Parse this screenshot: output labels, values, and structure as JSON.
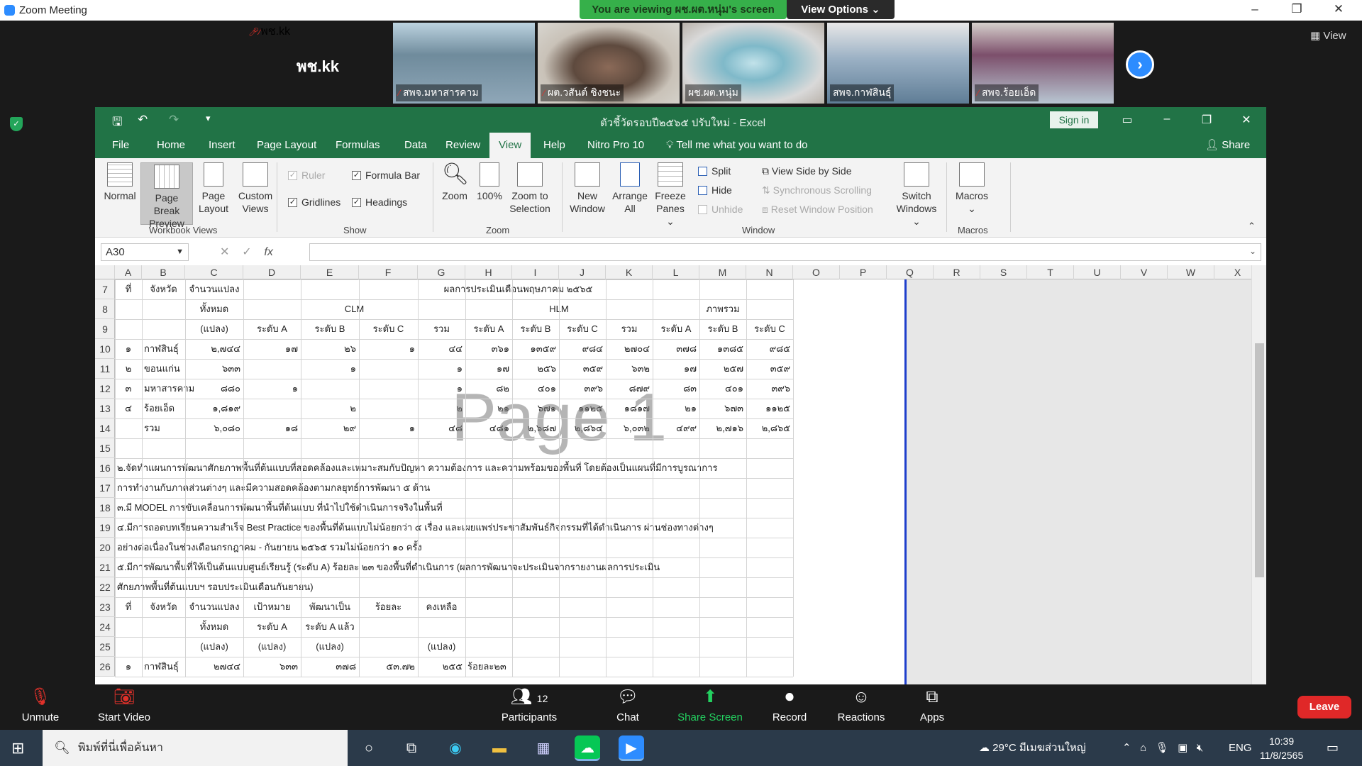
{
  "zoom": {
    "window_title": "Zoom Meeting",
    "viewing_banner": "You are viewing ผช.ผต.หนุ่ม's screen",
    "view_options": "View Options ⌄",
    "view_button": "View",
    "speaker_name_big": "พช.kk",
    "participants": [
      {
        "name": "พช.kk",
        "muted": true
      },
      {
        "name": "สพจ.มหาสารคาม",
        "muted": true
      },
      {
        "name": "ผต.วสันต์ ชิงชนะ",
        "muted": true
      },
      {
        "name": "ผช.ผต.หนุ่ม",
        "muted": false
      },
      {
        "name": "สพจ.กาฬสินธุ์",
        "muted": false
      },
      {
        "name": "สพจ.ร้อยเอ็ด",
        "muted": true
      }
    ],
    "toolbar": {
      "unmute": "Unmute",
      "start_video": "Start Video",
      "participants": "Participants",
      "participants_count": "12",
      "chat": "Chat",
      "share_screen": "Share Screen",
      "record": "Record",
      "reactions": "Reactions",
      "apps": "Apps",
      "leave": "Leave"
    }
  },
  "excel": {
    "title": "ตัวชี้วัดรอบปี๒๕๖๕ ปรับใหม่  -  Excel",
    "sign_in": "Sign in",
    "tabs": [
      "File",
      "Home",
      "Insert",
      "Page Layout",
      "Formulas",
      "Data",
      "Review",
      "View",
      "Help",
      "Nitro Pro 10"
    ],
    "active_tab": "View",
    "tell_me": "Tell me what you want to do",
    "share": "Share",
    "ribbon": {
      "normal": "Normal",
      "page_break_1": "Page Break",
      "page_break_2": "Preview",
      "page_layout_1": "Page",
      "page_layout_2": "Layout",
      "custom_views_1": "Custom",
      "custom_views_2": "Views",
      "group_workbook_views": "Workbook Views",
      "ruler": "Ruler",
      "formula_bar": "Formula Bar",
      "gridlines": "Gridlines",
      "headings": "Headings",
      "group_show": "Show",
      "zoom": "Zoom",
      "zoom100": "100%",
      "zoom_sel_1": "Zoom to",
      "zoom_sel_2": "Selection",
      "group_zoom": "Zoom",
      "new_window_1": "New",
      "new_window_2": "Window",
      "arrange_1": "Arrange",
      "arrange_2": "All",
      "freeze_1": "Freeze",
      "freeze_2": "Panes ⌄",
      "split": "Split",
      "hide": "Hide",
      "unhide": "Unhide",
      "view_side": "View Side by Side",
      "sync_scroll": "Synchronous Scrolling",
      "reset_pos": "Reset Window Position",
      "switch_1": "Switch",
      "switch_2": "Windows ⌄",
      "group_window": "Window",
      "macros": "Macros",
      "group_macros": "Macros"
    },
    "name_box": "A30",
    "fx": "fx",
    "columns": [
      "A",
      "B",
      "C",
      "D",
      "E",
      "F",
      "G",
      "H",
      "I",
      "J",
      "K",
      "L",
      "M",
      "N",
      "O",
      "P",
      "Q",
      "R",
      "S",
      "T",
      "U",
      "V",
      "W",
      "X"
    ],
    "rows": [
      "7",
      "8",
      "9",
      "10",
      "11",
      "12",
      "13",
      "14",
      "15",
      "16",
      "17",
      "18",
      "19",
      "20",
      "21",
      "22",
      "23",
      "24",
      "25",
      "26"
    ],
    "watermark": "Page 1",
    "sheet": {
      "r7": {
        "a": "ที่",
        "b": "จังหวัด",
        "c": "จำนวนแปลง",
        "merged": "ผลการประเมินเดือนพฤษภาคม ๒๕๖๕"
      },
      "r8": {
        "c": "ทั้งหมด",
        "clm": "CLM",
        "hlm": "HLM",
        "total": "ภาพรวม"
      },
      "r9": {
        "c": "(แปลง)",
        "d": "ระดับ A",
        "e": "ระดับ B",
        "f": "ระดับ C",
        "g": "รวม",
        "h": "ระดับ A",
        "i": "ระดับ B",
        "j": "ระดับ C",
        "k": "รวม",
        "l": "ระดับ A",
        "m": "ระดับ B",
        "n": "ระดับ C"
      },
      "data": [
        [
          "๑",
          "กาฬสินธุ์",
          "๒,๗๔๔",
          "๑๗",
          "๒๖",
          "๑",
          "๔๔",
          "๓๖๑",
          "๑๓๕๙",
          "๙๘๔",
          "๒๗๐๔",
          "๓๗๘",
          "๑๓๘๕",
          "๙๘๕"
        ],
        [
          "๒",
          "ขอนแก่น",
          "๖๓๓",
          "",
          "๑",
          "",
          "๑",
          "๑๗",
          "๒๕๖",
          "๓๕๙",
          "๖๓๒",
          "๑๗",
          "๒๕๗",
          "๓๕๙"
        ],
        [
          "๓",
          "มหาสารคาม",
          "๘๘๐",
          "๑",
          "",
          "",
          "๑",
          "๘๒",
          "๔๐๑",
          "๓๙๖",
          "๘๗๙",
          "๘๓",
          "๔๐๑",
          "๓๙๖"
        ],
        [
          "๔",
          "ร้อยเอ็ด",
          "๑,๘๑๙",
          "",
          "๒",
          "",
          "๒",
          "๒๑",
          "๖๗๑",
          "๑๑๒๕",
          "๑๘๑๗",
          "๒๑",
          "๖๗๓",
          "๑๑๒๕"
        ],
        [
          "",
          "รวม",
          "๖,๐๘๐",
          "๑๘",
          "๒๙",
          "๑",
          "๔๘",
          "๔๘๑",
          "๒,๖๘๗",
          "๒,๘๖๔",
          "๖,๐๓๒",
          "๔๙๙",
          "๒,๗๑๖",
          "๒,๘๖๕"
        ]
      ],
      "notes": [
        "๒.จัดทำแผนการพัฒนาศักยภาพพื้นที่ต้นแบบที่สอดคล้องและเหมาะสมกับปัญหา ความต้องการ และความพร้อมของพื้นที่ โดยต้องเป็นแผนที่มีการบูรณาการ",
        "การทำงานกับภาคส่วนต่างๆ และมีความสอดคล้องตามกลยุทธ์การพัฒนา ๕ ด้าน",
        "๓.มี MODEL การขับเคลื่อนการพัฒนาพื้นที่ต้นแบบ ที่นำไปใช้ดำเนินการจริงในพื้นที่",
        "๔.มีการถอดบทเรียนความสำเร็จ Best Practice ของพื้นที่ต้นแบบไม่น้อยกว่า ๕ เรื่อง และเผยแพร่ประชาสัมพันธ์กิจกรรมที่ได้ดำเนินการ ผ่านช่องทางต่างๆ",
        "อย่างต่อเนื่องในช่วงเดือนกรกฎาคม - กันยายน ๒๕๖๕ รวมไม่น้อยกว่า ๑๐ ครั้ง",
        "๕.มีการพัฒนาพื้นที่ให้เป็นต้นแบบศูนย์เรียนรู้ (ระดับ A) ร้อยละ ๒๓ ของพื้นที่ดำเนินการ (ผลการพัฒนาจะประเมินจากรายงานผลการประเมิน",
        "ศักยภาพพื้นที่ต้นแบบฯ รอบประเมินเดือนกันยายน)"
      ],
      "r23": {
        "a": "ที่",
        "b": "จังหวัด",
        "c": "จำนวนแปลง",
        "d": "เป้าหมาย",
        "e": "พัฒนาเป็น",
        "f": "ร้อยละ",
        "g": "คงเหลือ"
      },
      "r24": {
        "c": "ทั้งหมด",
        "d": "ระดับ A",
        "e": "ระดับ A แล้ว"
      },
      "r25": {
        "c": "(แปลง)",
        "d": "(แปลง)",
        "e": "(แปลง)",
        "g": "(แปลง)"
      },
      "r26": {
        "a": "๑",
        "b": "กาฬสินธุ์",
        "c": "๒๗๔๔",
        "d": "๖๓๓",
        "e": "๓๗๘",
        "f": "๕๓.๗๒",
        "g": "๒๕๕",
        "h": "ร้อยละ๒๓"
      }
    }
  },
  "taskbar": {
    "search_placeholder": "พิมพ์ที่นี่เพื่อค้นหา",
    "weather": "29°C  มีเมฆส่วนใหญ่",
    "lang": "ENG",
    "time": "10:39",
    "date": "11/8/2565"
  },
  "colors": {
    "excel_green": "#217346",
    "zoom_blue": "#2d8cff",
    "banner_green": "#36b04a",
    "leave_red": "#e02828",
    "page_break_blue": "#1f3fcc"
  }
}
